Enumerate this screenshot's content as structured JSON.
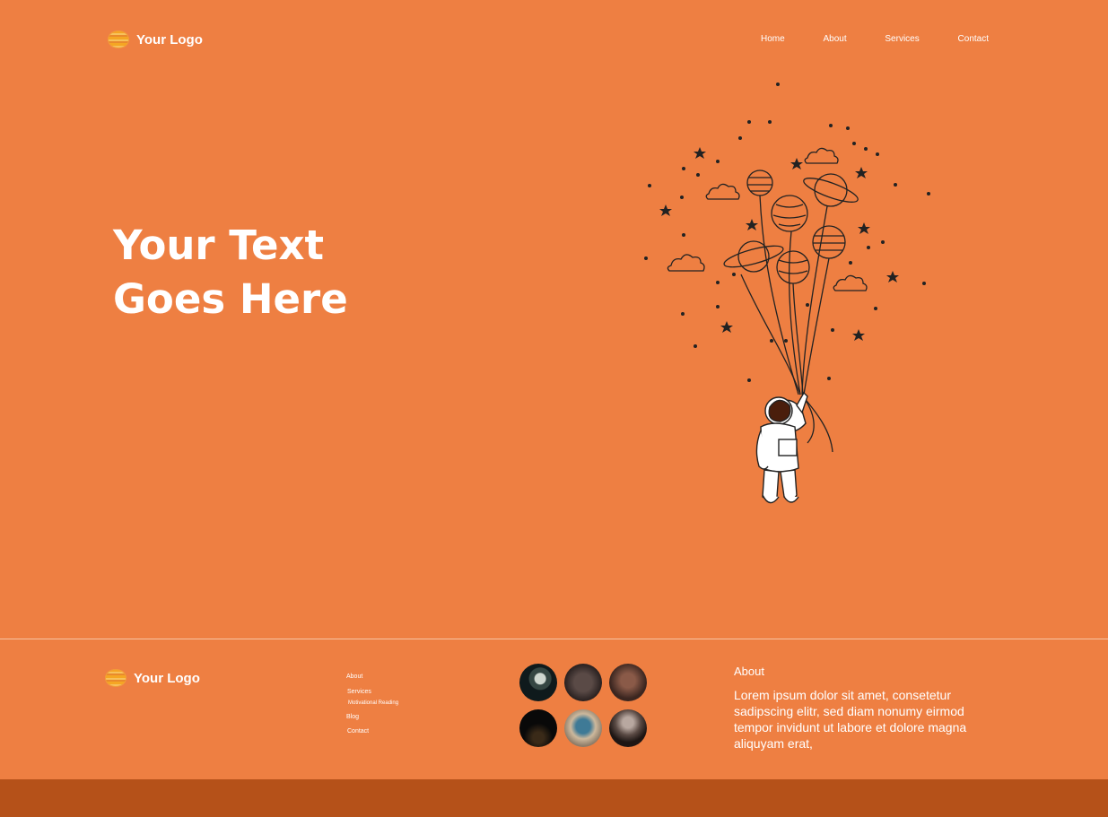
{
  "header": {
    "logo_text": "Your Logo",
    "logo_icon": "planet-logo-icon",
    "nav": [
      "Home",
      "About",
      "Services",
      "Contact"
    ]
  },
  "hero": {
    "title_line1": "Your Text",
    "title_line2": "Goes Here",
    "illustration": "astronaut-with-planet-balloons"
  },
  "footer": {
    "logo_text": "Your Logo",
    "links": {
      "about": "About",
      "services": "Services",
      "motivational": "Motivational Reading",
      "blog": "Blog",
      "contact": "Contact"
    },
    "gallery_count": 6,
    "about_title": "About",
    "about_text": "Lorem ipsum dolor sit amet, consetetur sadipscing elitr, sed diam nonumy eirmod tempor invidunt ut labore et dolore magna aliquyam erat,"
  },
  "colors": {
    "background": "#ee7f42",
    "bottom_bar": "#b55119",
    "text": "#ffffff"
  }
}
